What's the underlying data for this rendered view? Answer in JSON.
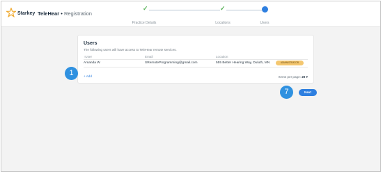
{
  "header": {
    "brand": "Starkey",
    "product": "TeleHear",
    "separator": " • ",
    "page_title": "Registration"
  },
  "stepper": {
    "steps": [
      {
        "label": "Practice Details",
        "state": "complete"
      },
      {
        "label": "Locations",
        "state": "complete"
      },
      {
        "label": "Users",
        "state": "current"
      }
    ],
    "check_glyph": "✓"
  },
  "users_card": {
    "title": "Users",
    "subtitle": "The following users will have access to TeleHear remote services.",
    "columns": [
      "↑User",
      "Email",
      "Location"
    ],
    "rows": [
      {
        "user": "Amanda W",
        "email": "SRemoteProgramming@gmail.com",
        "location": "555 Better Hearing Way, Duluth, MN",
        "role": "ADMINISTRATOR"
      }
    ],
    "add_label": "+ Add",
    "items_per_page_label": "Items per page:",
    "items_per_page_value": "20 ▾"
  },
  "markers": {
    "left": "1",
    "right": "7"
  },
  "footer": {
    "next_label": "Next"
  },
  "colors": {
    "accent": "#2e7fe0",
    "marker": "#2f91e0",
    "badge": "#f4c770",
    "check": "#5ab35a"
  }
}
